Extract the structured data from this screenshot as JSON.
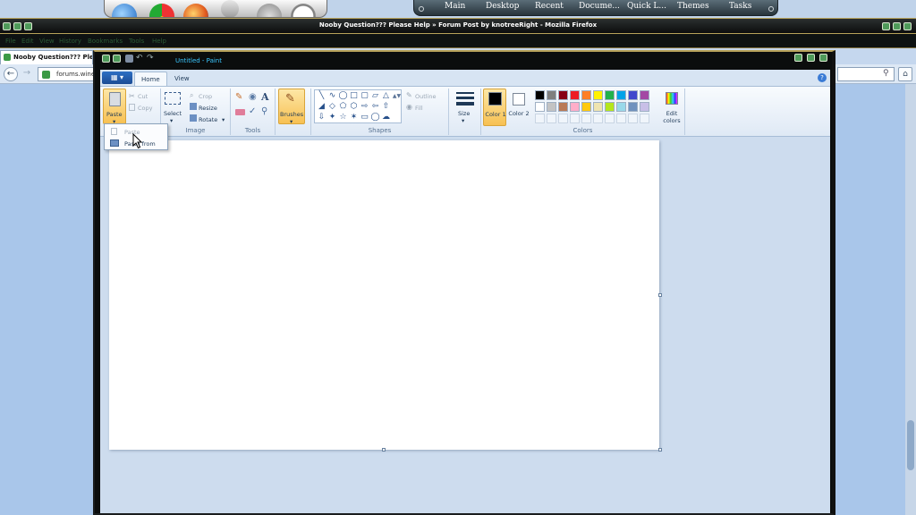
{
  "dock": {
    "apps": [
      "internet-explorer-orb",
      "chrome-orb",
      "firefox-orb",
      "recycle-orb",
      "clock-orb"
    ],
    "menu": [
      "Main",
      "Desktop",
      "Recent",
      "Docume...",
      "Quick L...",
      "Themes",
      "Tasks"
    ]
  },
  "firefox": {
    "title": "Nooby Question??? Please Help » Forum Post by knotreeRight - Mozilla Firefox",
    "menu": [
      "File",
      "Edit",
      "View",
      "History",
      "Bookmarks",
      "Tools",
      "Help"
    ],
    "tab_title": "Nooby Question??? Please",
    "url": "forums.wine"
  },
  "paint": {
    "title": "Untitled - Paint",
    "tabs": [
      "Home",
      "View"
    ],
    "help": "?",
    "clipboard": {
      "paste": "Paste",
      "cut": "Cut",
      "copy": "Copy"
    },
    "image": {
      "select": "Select",
      "crop": "Crop",
      "resize": "Resize",
      "rotate": "Rotate",
      "label": "Image"
    },
    "tools": {
      "label": "Tools"
    },
    "brushes": {
      "label": "Brushes"
    },
    "shapes": {
      "outline": "Outline",
      "fill": "Fill",
      "label": "Shapes"
    },
    "size": {
      "label": "Size"
    },
    "colors": {
      "color1": "Color 1",
      "color2": "Color 2",
      "edit": "Edit colors",
      "label": "Colors",
      "color1_value": "#000000",
      "color2_value": "#ffffff",
      "palette_row1": [
        "#000000",
        "#7f7f7f",
        "#880015",
        "#ed1c24",
        "#ff7f27",
        "#fff200",
        "#22b14c",
        "#00a2e8",
        "#3f48cc",
        "#a349a4"
      ],
      "palette_row2": [
        "#ffffff",
        "#c3c3c3",
        "#b97a57",
        "#ffaec9",
        "#ffc90e",
        "#efe4b0",
        "#b5e61d",
        "#99d9ea",
        "#7092be",
        "#c8bfe7"
      ]
    },
    "paste_menu": {
      "paste": "Paste",
      "paste_from": "Paste from"
    }
  }
}
